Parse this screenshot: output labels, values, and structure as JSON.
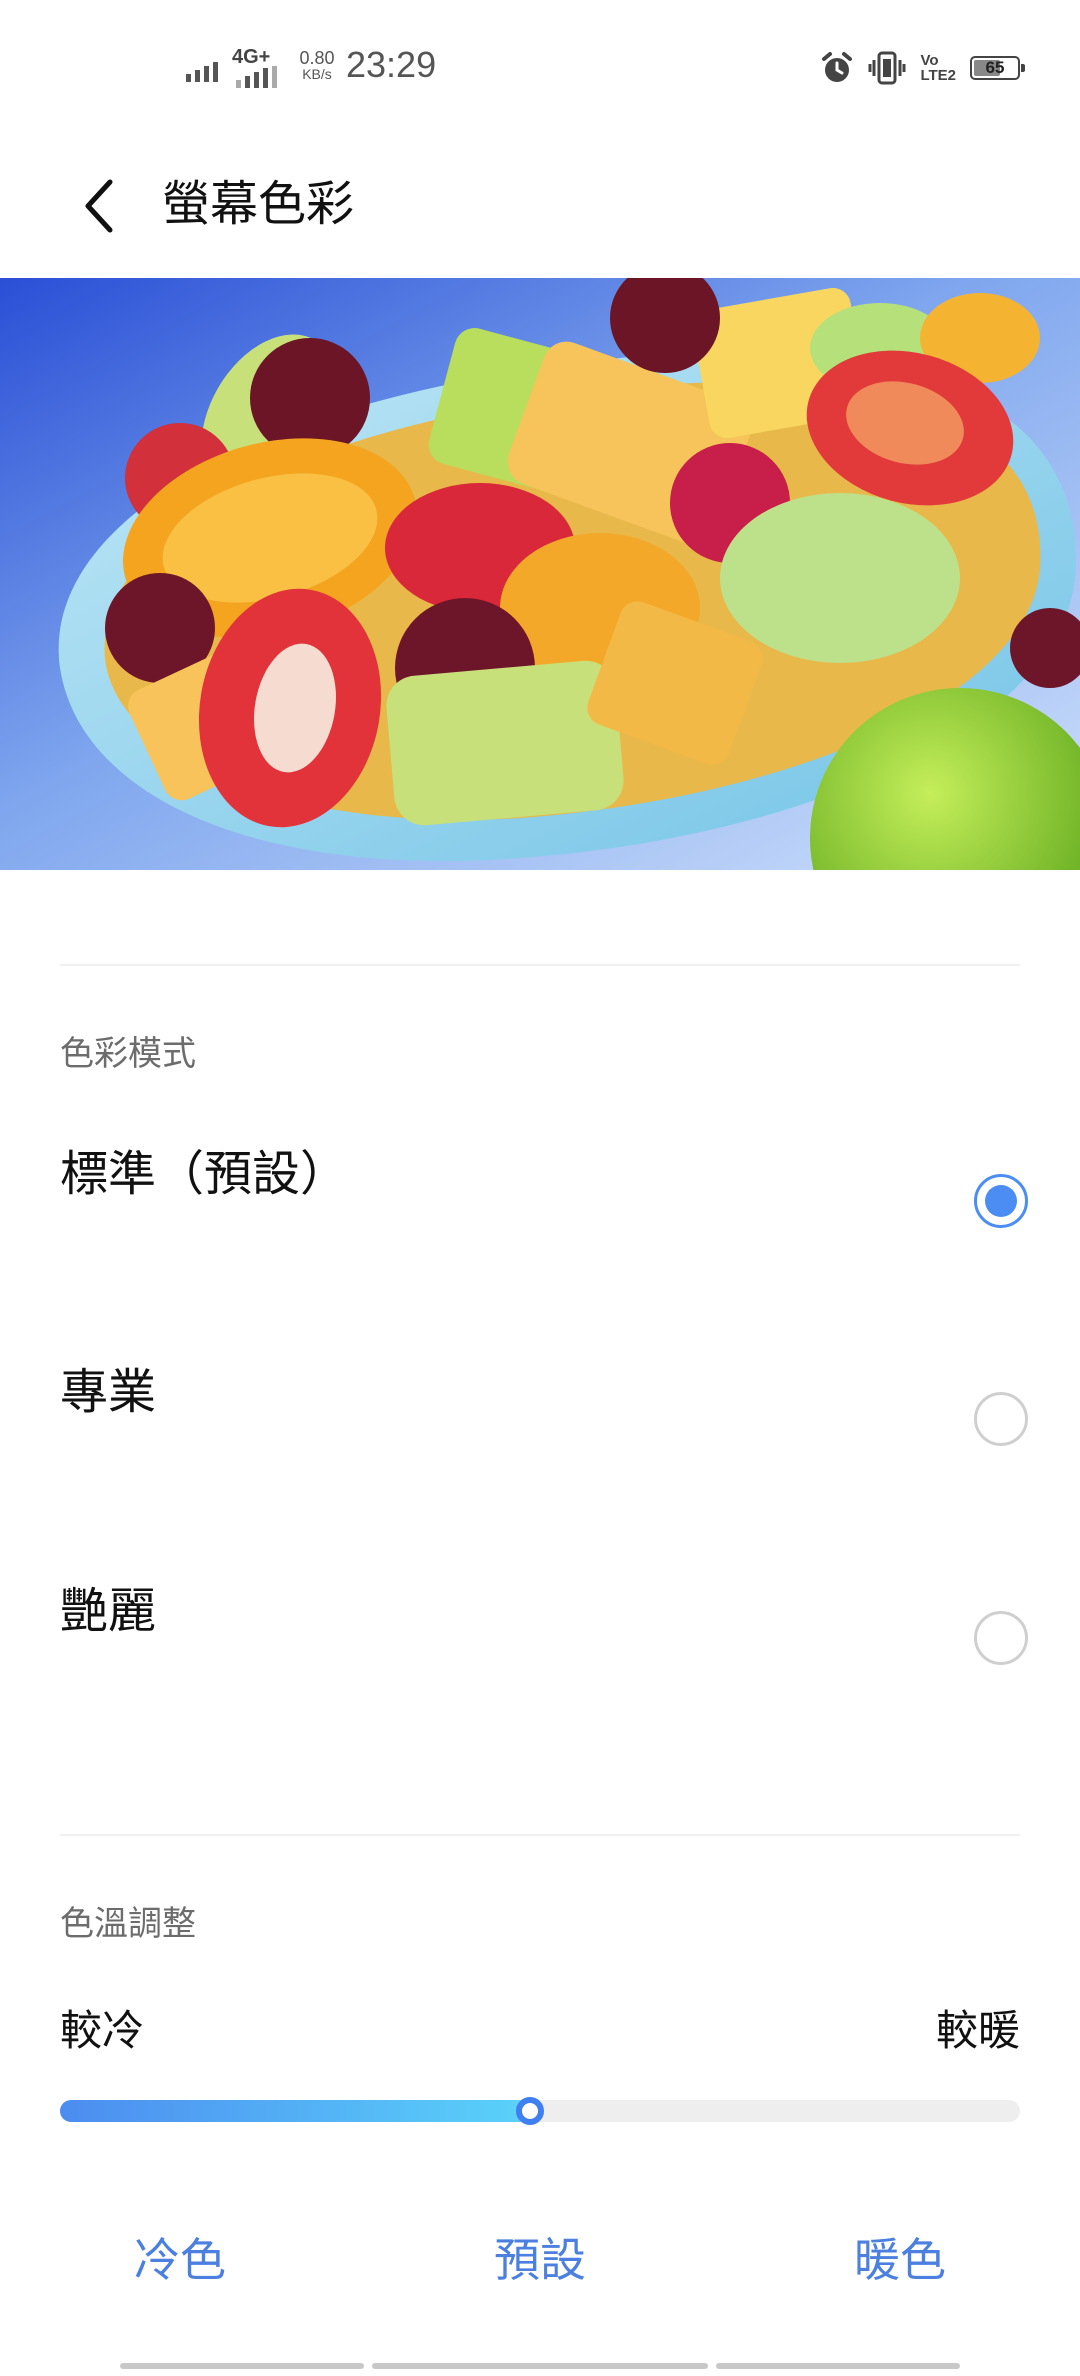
{
  "status_bar": {
    "network_type": "4G+",
    "speed_value": "0.80",
    "speed_unit": "KB/s",
    "time": "23:29",
    "volte_line1": "Vo",
    "volte_line2": "LTE2",
    "battery_level": "65",
    "icons": [
      "signal-icon",
      "mobile-data-icon",
      "alarm-icon",
      "vibrate-icon",
      "volte-icon",
      "battery-icon"
    ]
  },
  "header": {
    "back_icon": "chevron-left-icon",
    "title": "螢幕色彩"
  },
  "preview": {
    "subject": "fruit-salad-photo"
  },
  "color_mode": {
    "section_title": "色彩模式",
    "options": [
      {
        "label": "標準（預設）",
        "selected": true
      },
      {
        "label": "專業",
        "selected": false
      },
      {
        "label": "艷麗",
        "selected": false
      }
    ]
  },
  "color_temperature": {
    "section_title": "色溫調整",
    "cooler_label": "較冷",
    "warmer_label": "較暖",
    "slider_value": 0.49,
    "presets": {
      "cool": "冷色",
      "default": "預設",
      "warm": "暖色"
    }
  },
  "colors": {
    "accent": "#4b8df2",
    "preset_text": "#4b7fe0",
    "slider_start": "#4c8cf0",
    "slider_end": "#5ad2fa"
  }
}
